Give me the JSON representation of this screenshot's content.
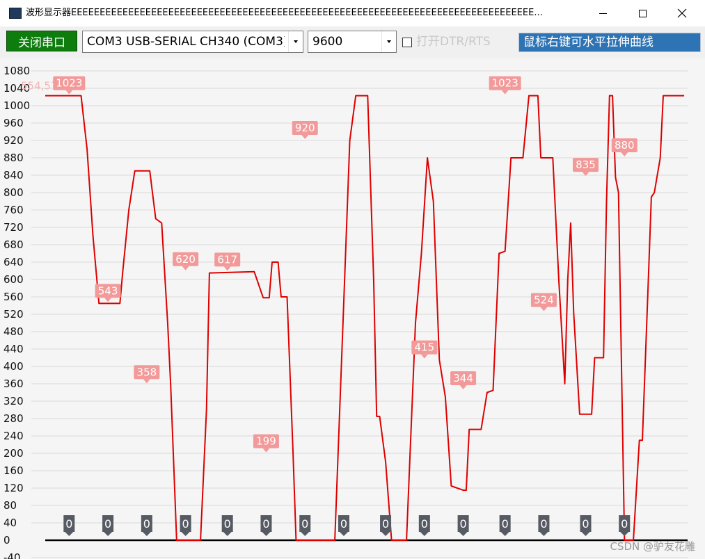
{
  "window": {
    "title": "波形显示器EEEEEEEEEEEEEEEEEEEEEEEEEEEEEEEEEEEEEEEEEEEEEEEEEEEEEEEEEEEEEEEEEEEEEEEEEEEEEEEEE...",
    "icon": "app-icon",
    "controls": [
      "minimize-icon",
      "maximize-icon",
      "close-icon"
    ]
  },
  "toolbar": {
    "close_port_label": "关闭串口",
    "port_value": "COM3 USB-SERIAL CH340 (COM3)",
    "baud_value": "9600",
    "dtr_label": "打开DTR/RTS",
    "dtr_checked": false,
    "hint": "鼠标右键可水平拉伸曲线"
  },
  "colors": {
    "close_port_button": "#0e7d0e",
    "hint_box": "#2e74b5",
    "curve": "#dd0000",
    "value_marker": "#f29a9a",
    "zero_marker": "#555a63",
    "baseline": "#000000",
    "gridline": "#d9d9d9"
  },
  "chart_data": {
    "type": "line",
    "xlabel": "",
    "ylabel": "",
    "ylim": [
      -40,
      1080
    ],
    "y_ticks": [
      -40,
      0,
      40,
      80,
      120,
      160,
      200,
      240,
      280,
      320,
      360,
      400,
      440,
      480,
      520,
      560,
      600,
      640,
      680,
      720,
      760,
      800,
      840,
      880,
      920,
      960,
      1000,
      1040,
      1080
    ],
    "grid": true,
    "cursor_readout": "554,574",
    "series": [
      {
        "points": [
          [
            0,
            1023
          ],
          [
            12,
            1023
          ],
          [
            14,
            900
          ],
          [
            16,
            700
          ],
          [
            18,
            545
          ],
          [
            25,
            545
          ],
          [
            26,
            620
          ],
          [
            28,
            760
          ],
          [
            30,
            850
          ],
          [
            35,
            850
          ],
          [
            37,
            740
          ],
          [
            39,
            730
          ],
          [
            41,
            500
          ],
          [
            42,
            358
          ],
          [
            44,
            0
          ],
          [
            52,
            0
          ],
          [
            54,
            300
          ],
          [
            55,
            615
          ],
          [
            70,
            618
          ],
          [
            73,
            558
          ],
          [
            75,
            558
          ],
          [
            76,
            640
          ],
          [
            78,
            640
          ],
          [
            79,
            560
          ],
          [
            81,
            560
          ],
          [
            83,
            199
          ],
          [
            84,
            0
          ],
          [
            97,
            0
          ],
          [
            100,
            550
          ],
          [
            102,
            920
          ],
          [
            104,
            1023
          ],
          [
            108,
            1023
          ],
          [
            110,
            600
          ],
          [
            111,
            285
          ],
          [
            112,
            285
          ],
          [
            114,
            180
          ],
          [
            116,
            0
          ],
          [
            121,
            0
          ],
          [
            124,
            500
          ],
          [
            126,
            660
          ],
          [
            128,
            880
          ],
          [
            130,
            780
          ],
          [
            132,
            415
          ],
          [
            134,
            330
          ],
          [
            136,
            125
          ],
          [
            140,
            115
          ],
          [
            141,
            115
          ],
          [
            142,
            255
          ],
          [
            146,
            255
          ],
          [
            148,
            340
          ],
          [
            150,
            345
          ],
          [
            152,
            660
          ],
          [
            154,
            665
          ],
          [
            156,
            880
          ],
          [
            160,
            880
          ],
          [
            162,
            1023
          ],
          [
            165,
            1023
          ],
          [
            166,
            880
          ],
          [
            170,
            880
          ],
          [
            172,
            600
          ],
          [
            174,
            360
          ],
          [
            175,
            600
          ],
          [
            176,
            730
          ],
          [
            177,
            524
          ],
          [
            179,
            290
          ],
          [
            183,
            290
          ],
          [
            184,
            420
          ],
          [
            187,
            420
          ],
          [
            188,
            780
          ],
          [
            189,
            1023
          ],
          [
            190,
            1023
          ],
          [
            191,
            835
          ],
          [
            192,
            800
          ],
          [
            193,
            400
          ],
          [
            194,
            0
          ],
          [
            197,
            0
          ],
          [
            199,
            230
          ],
          [
            200,
            230
          ],
          [
            202,
            600
          ],
          [
            203,
            790
          ],
          [
            204,
            800
          ],
          [
            206,
            880
          ],
          [
            207,
            1023
          ],
          [
            214,
            1023
          ]
        ],
        "value_markers": [
          {
            "x": 8,
            "y": 1023,
            "label": "1023"
          },
          {
            "x": 21,
            "y": 545,
            "label": "543"
          },
          {
            "x": 34,
            "y": 358,
            "label": "358"
          },
          {
            "x": 47,
            "y": 618,
            "label": "620"
          },
          {
            "x": 61,
            "y": 617,
            "label": "617"
          },
          {
            "x": 74,
            "y": 199,
            "label": "199"
          },
          {
            "x": 87,
            "y": 920,
            "label": "920"
          },
          {
            "x": 127,
            "y": 415,
            "label": "415"
          },
          {
            "x": 140,
            "y": 344,
            "label": "344"
          },
          {
            "x": 154,
            "y": 1023,
            "label": "1023"
          },
          {
            "x": 167,
            "y": 524,
            "label": "524"
          },
          {
            "x": 181,
            "y": 835,
            "label": "835"
          },
          {
            "x": 194,
            "y": 880,
            "label": "880"
          }
        ],
        "zero_markers": [
          {
            "x": 8,
            "label": "0"
          },
          {
            "x": 21,
            "label": "0"
          },
          {
            "x": 34,
            "label": "0"
          },
          {
            "x": 47,
            "label": "0"
          },
          {
            "x": 61,
            "label": "0"
          },
          {
            "x": 74,
            "label": "0"
          },
          {
            "x": 87,
            "label": "0"
          },
          {
            "x": 100,
            "label": "0"
          },
          {
            "x": 114,
            "label": "0"
          },
          {
            "x": 127,
            "label": "0"
          },
          {
            "x": 140,
            "label": "0"
          },
          {
            "x": 154,
            "label": "0"
          },
          {
            "x": 167,
            "label": "0"
          },
          {
            "x": 181,
            "label": "0"
          },
          {
            "x": 194,
            "label": "0"
          }
        ]
      }
    ]
  },
  "watermark": "CSDN @驴友花雕"
}
